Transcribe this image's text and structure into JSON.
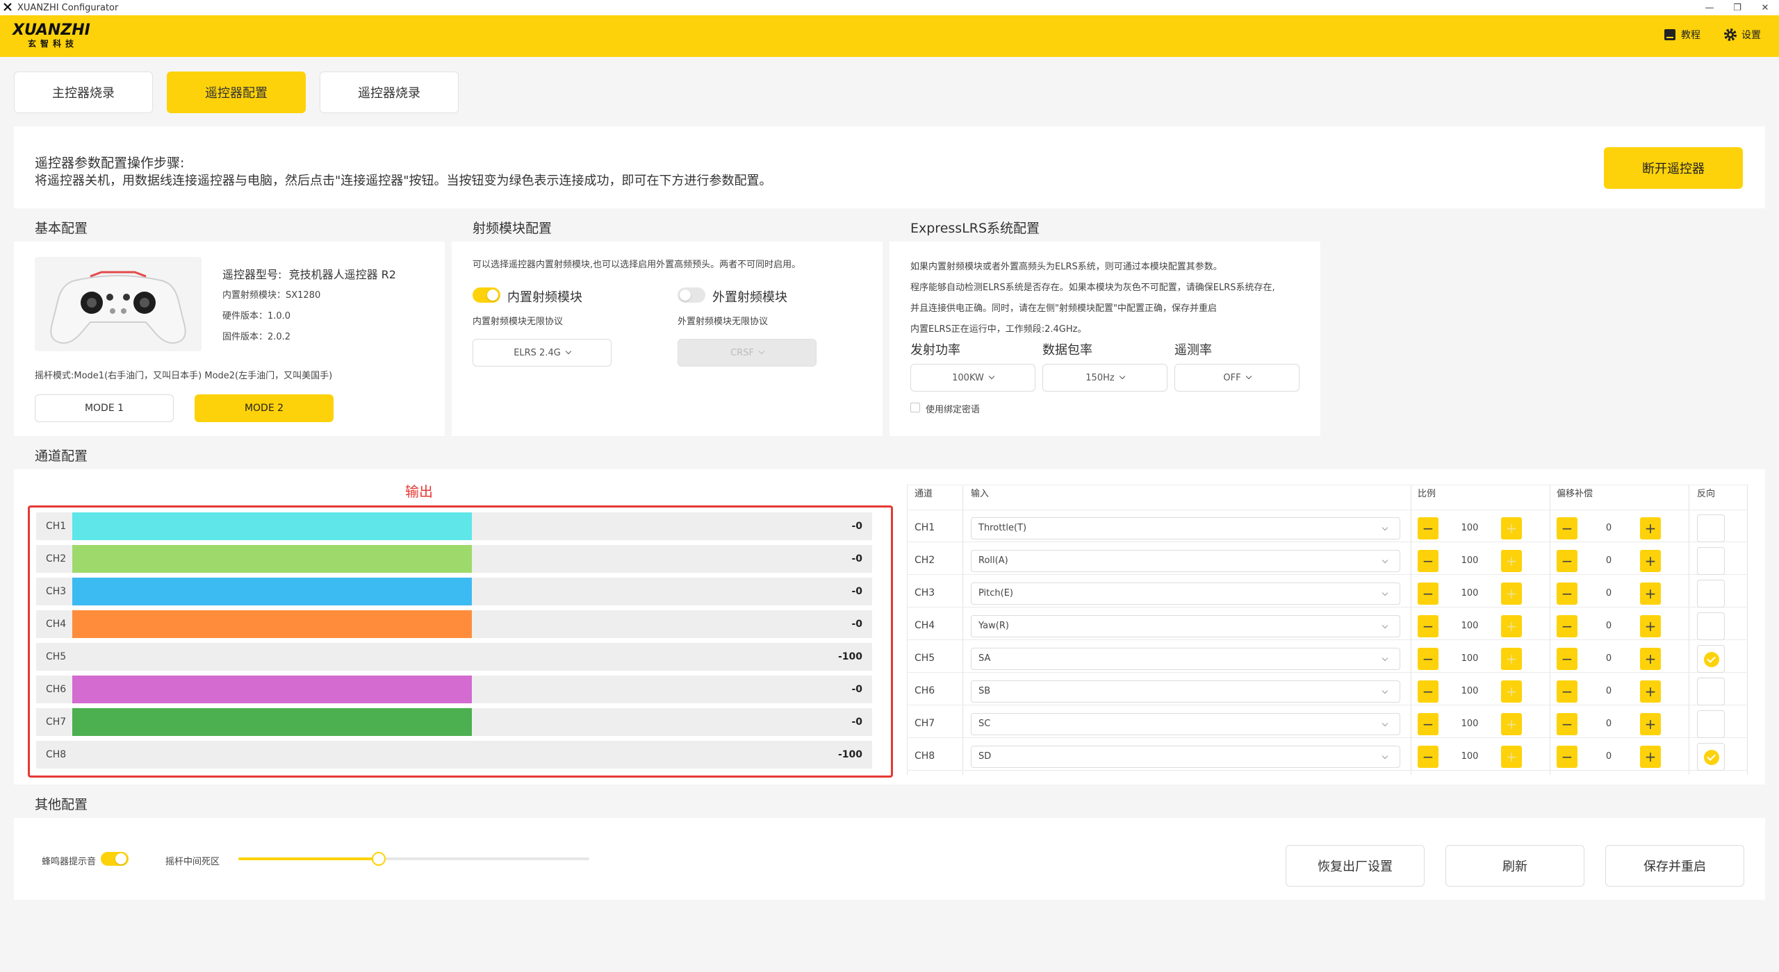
{
  "window": {
    "title": "XUANZHI Configurator"
  },
  "header": {
    "logo_text": "XUANZHI",
    "logo_subtext": "玄智科技",
    "tutorial_label": "教程",
    "settings_label": "设置",
    "brand_color": "#fdd20a"
  },
  "tabs": [
    {
      "label": "主控器烧录",
      "active": false
    },
    {
      "label": "遥控器配置",
      "active": true
    },
    {
      "label": "遥控器烧录",
      "active": false
    }
  ],
  "instructions": {
    "title": "遥控器参数配置操作步骤:",
    "text": "将遥控器关机，用数据线连接遥控器与电脑，然后点击\"连接遥控器\"按钮。当按钮变为绿色表示连接成功，即可在下方进行参数配置。",
    "disconnect_label": "断开遥控器"
  },
  "basic": {
    "title": "基本配置",
    "model_label": "遥控器型号:",
    "model_value": "竞技机器人遥控器 R2",
    "rf_module": "内置射频模块：SX1280",
    "hw_version": "硬件版本：1.0.0",
    "fw_version": "固件版本：2.0.2",
    "stick_mode_desc": "摇杆模式:Mode1(右手油门，又叫日本手) Mode2(左手油门，又叫美国手)",
    "mode1_label": "MODE 1",
    "mode2_label": "MODE 2"
  },
  "rf": {
    "title": "射频模块配置",
    "desc": "可以选择遥控器内置射频模块,也可以选择启用外置高频预头。两者不可同时启用。",
    "internal_label": "内置射频模块",
    "internal_on": true,
    "external_label": "外置射频模块",
    "external_on": false,
    "internal_protocol_label": "内置射频模块无限协议",
    "internal_protocol_value": "ELRS 2.4G",
    "external_protocol_label": "外置射频模块无限协议",
    "external_protocol_value": "CRSF"
  },
  "elrs": {
    "title": "ExpressLRS系统配置",
    "desc_lines": [
      "如果内置射频模块或者外置高频头为ELRS系统，则可通过本模块配置其参数。",
      "程序能够自动检测ELRS系统是否存在。如果本模块为灰色不可配置，请确保ELRS系统存在,",
      "并且连接供电正确。同时，请在左侧\"射频模块配置\"中配置正确，保存并重启",
      "内置ELRS正在运行中，工作频段:2.4GHz。"
    ],
    "power_label": "发射功率",
    "power_value": "100KW",
    "rate_label": "数据包率",
    "rate_value": "150Hz",
    "telemetry_label": "遥测率",
    "telemetry_value": "OFF",
    "bind_phrase_label": "使用绑定密语"
  },
  "channels": {
    "title": "通道配置",
    "output_label": "输出",
    "bars": [
      {
        "name": "CH1",
        "value": "-0",
        "color": "#5ee6e8",
        "fill": 0.5
      },
      {
        "name": "CH2",
        "value": "-0",
        "color": "#9ed96b",
        "fill": 0.5
      },
      {
        "name": "CH3",
        "value": "-0",
        "color": "#3cbaf2",
        "fill": 0.5
      },
      {
        "name": "CH4",
        "value": "-0",
        "color": "#ff8c3b",
        "fill": 0.5
      },
      {
        "name": "CH5",
        "value": "-100",
        "color": "#eeeeee",
        "fill": 0
      },
      {
        "name": "CH6",
        "value": "-0",
        "color": "#d36bd0",
        "fill": 0.5
      },
      {
        "name": "CH7",
        "value": "-0",
        "color": "#4caf50",
        "fill": 0.5
      },
      {
        "name": "CH8",
        "value": "-100",
        "color": "#eeeeee",
        "fill": 0
      }
    ],
    "table_headers": {
      "channel": "通道",
      "input": "输入",
      "ratio": "比例",
      "offset": "偏移补偿",
      "reverse": "反向"
    },
    "rows": [
      {
        "ch": "CH1",
        "input": "Throttle(T)",
        "ratio": "100",
        "offset": "0",
        "reverse": false
      },
      {
        "ch": "CH2",
        "input": "Roll(A)",
        "ratio": "100",
        "offset": "0",
        "reverse": false
      },
      {
        "ch": "CH3",
        "input": "Pitch(E)",
        "ratio": "100",
        "offset": "0",
        "reverse": false
      },
      {
        "ch": "CH4",
        "input": "Yaw(R)",
        "ratio": "100",
        "offset": "0",
        "reverse": false
      },
      {
        "ch": "CH5",
        "input": "SA",
        "ratio": "100",
        "offset": "0",
        "reverse": true
      },
      {
        "ch": "CH6",
        "input": "SB",
        "ratio": "100",
        "offset": "0",
        "reverse": false
      },
      {
        "ch": "CH7",
        "input": "SC",
        "ratio": "100",
        "offset": "0",
        "reverse": false
      },
      {
        "ch": "CH8",
        "input": "SD",
        "ratio": "100",
        "offset": "0",
        "reverse": true
      }
    ],
    "minus": "−",
    "plus": "+"
  },
  "other": {
    "title": "其他配置",
    "buzzer_label": "蜂鸣器提示音",
    "buzzer_on": true,
    "deadzone_label": "摇杆中间死区",
    "deadzone_level": 0.4,
    "factory_reset_label": "恢复出厂设置",
    "refresh_label": "刷新",
    "save_reboot_label": "保存并重启"
  }
}
